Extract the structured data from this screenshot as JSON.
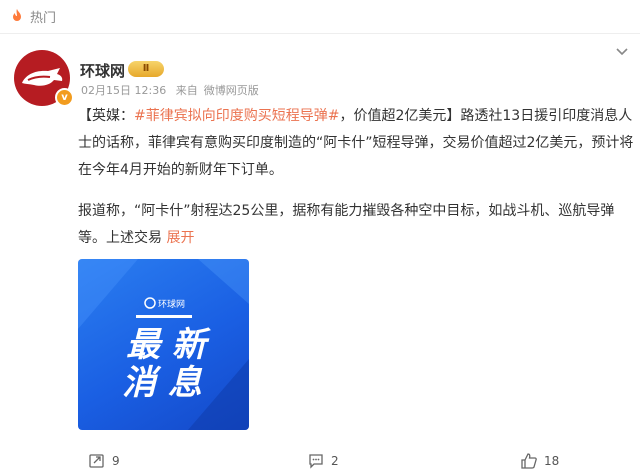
{
  "tab": {
    "label": "热门",
    "icon": "flame-icon"
  },
  "post": {
    "author": "环球网",
    "badge": "Ⅱ",
    "date": "02月15日 12:36",
    "source_prefix": "来自",
    "source": "微博网页版",
    "para1_prefix": "【英媒：",
    "topic_tag": "#菲律宾拟向印度购买短程导弹#",
    "para1_rest": "，价值超2亿美元】路透社13日援引印度消息人士的话称，菲律宾有意购买印度制造的“阿卡什”短程导弹，交易价值超过2亿美元，预计将在今年4月开始的新财年下订单。",
    "para2": "报道称，“阿卡什”射程达25公里，据称有能力摧毁各种空中目标，如战斗机、巡航导弹等。上述交易 ",
    "expand_label": "展开",
    "image": {
      "logo_text": "环球网",
      "line1": "最 新",
      "line2": "消 息"
    }
  },
  "actions": {
    "repost_count": "9",
    "comment_count": "2",
    "like_count": "18"
  },
  "colors": {
    "accent": "#eb7350",
    "brand_red": "#b61c22",
    "image_blue": "#1a5fe3"
  }
}
